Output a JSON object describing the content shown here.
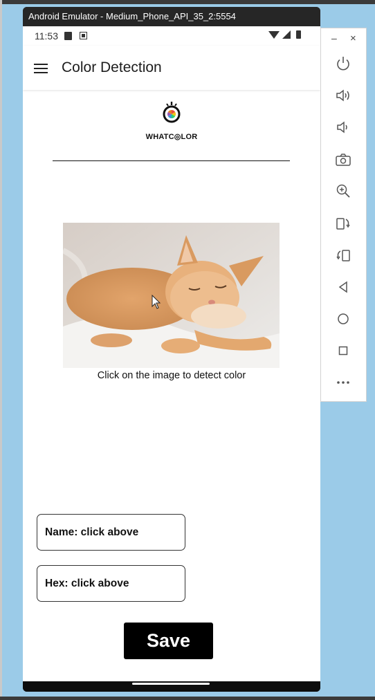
{
  "emulator": {
    "window_title": "Android Emulator - Medium_Phone_API_35_2:5554",
    "toolbar": {
      "minimize_label": "–",
      "close_label": "×",
      "buttons": [
        "power-icon",
        "volume-up-icon",
        "volume-down-icon",
        "camera-icon",
        "zoom-icon",
        "rotate-left-icon",
        "rotate-right-icon",
        "back-icon",
        "home-icon",
        "overview-icon",
        "more-icon"
      ]
    }
  },
  "status_bar": {
    "time": "11:53"
  },
  "app": {
    "title": "Color Detection",
    "logo_text": "WHATC◎LOR",
    "caption": "Click on the image to detect color",
    "name_field": "Name: click above",
    "hex_field": "Hex: click above",
    "save_label": "Save"
  },
  "colors": {
    "accent": "#000000",
    "desktop": "#9bcbe8"
  }
}
